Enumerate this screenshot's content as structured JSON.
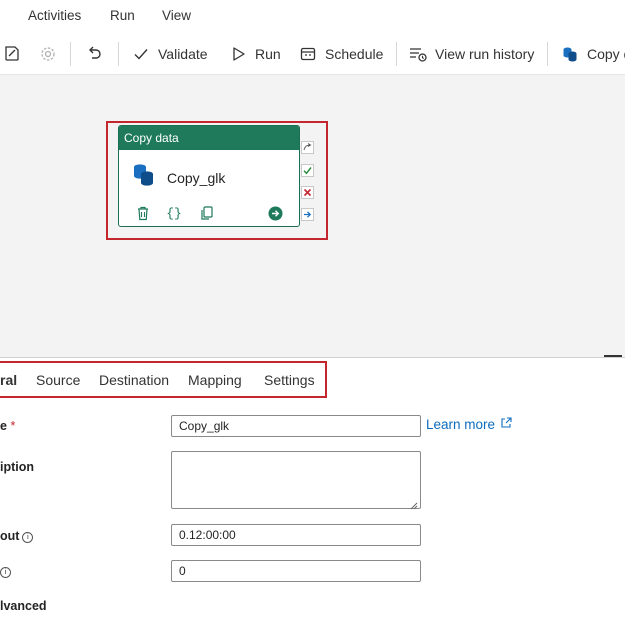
{
  "menu": {
    "items": [
      "Activities",
      "Run",
      "View"
    ]
  },
  "toolbar": {
    "validate_label": "Validate",
    "run_label": "Run",
    "schedule_label": "Schedule",
    "view_run_history_label": "View run history",
    "copy_label": "Copy d"
  },
  "canvas": {
    "activity": {
      "header": "Copy data",
      "name": "Copy_glk",
      "icon": "database-copy-icon",
      "actions": [
        "delete-icon",
        "code-braces-icon",
        "duplicate-icon",
        "go-arrow-icon"
      ]
    },
    "handles": [
      "redirect-icon",
      "success-check-icon",
      "failure-x-icon",
      "completion-arrow-icon"
    ]
  },
  "properties": {
    "tabs": [
      "ral",
      "Source",
      "Destination",
      "Mapping",
      "Settings"
    ],
    "active_tab": "ral",
    "fields": {
      "name": {
        "label": "e",
        "required_mark": "*",
        "value": "Copy_glk"
      },
      "description": {
        "label": "iption",
        "value": ""
      },
      "timeout": {
        "label": "out",
        "value": "0.12:00:00"
      },
      "retry": {
        "label": "",
        "value": "0"
      },
      "advanced": {
        "label": "lvanced"
      }
    },
    "learn_more": "Learn more"
  },
  "colors": {
    "accent_green": "#1e7a5a",
    "highlight_red": "#c4262e",
    "link_blue": "#0f6cbd",
    "canvas_bg": "#f3f3f3"
  }
}
